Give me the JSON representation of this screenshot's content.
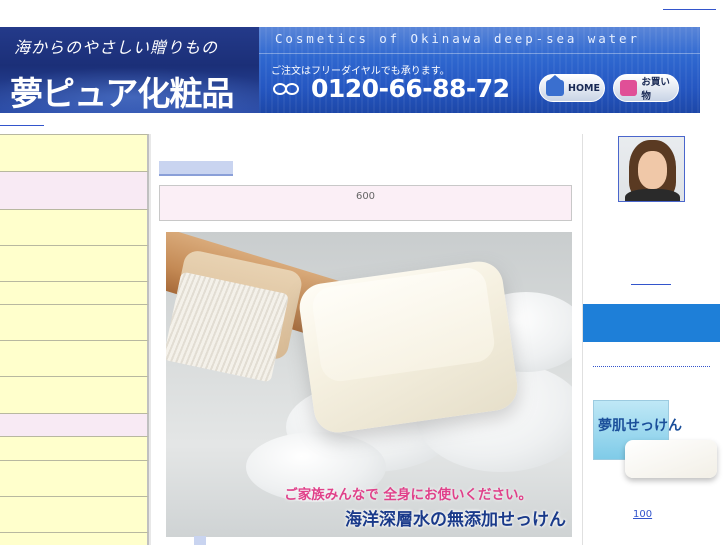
{
  "banner": {
    "tagline": "海からのやさしい贈りもの",
    "brand_name": "夢ピュア化粧品",
    "english_tagline": "Cosmetics of Okinawa deep-sea water",
    "order_note": "ご注文はフリーダイヤルでも承ります。",
    "phone": "0120-66-88-72",
    "home_button": "HOME",
    "shop_button": "お買い物"
  },
  "main": {
    "notice_text": "600",
    "photo": {
      "caption_line1": "ご家族みんなで 全身にお使いください。",
      "caption_line2": "海洋深層水の無添加せっけん"
    }
  },
  "right_sidebar": {
    "product_box_label": "夢肌せっけん",
    "product_price": "100"
  },
  "colors": {
    "banner_dark": "#1b2f78",
    "banner_light": "#2f68d0",
    "sidebar_yellow": "#ffffcc",
    "sidebar_pink": "#f8eaf4",
    "accent_blue": "#1e7fd8",
    "caption_pink": "#e0418a",
    "caption_navy": "#1a3a8a"
  }
}
